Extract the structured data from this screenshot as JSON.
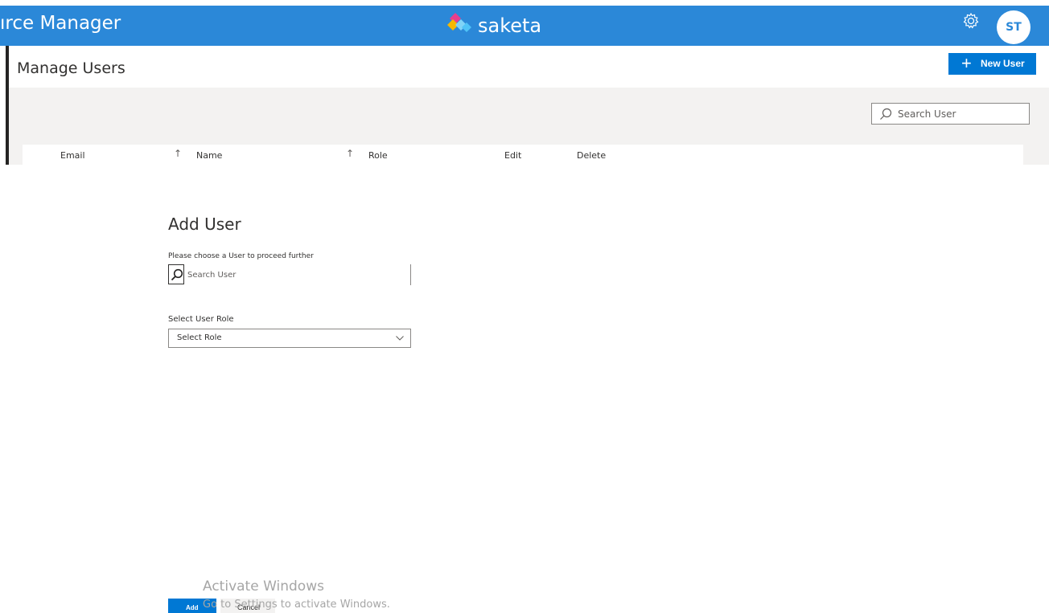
{
  "header": {
    "app_title": "ırce Manager",
    "brand": "saketa",
    "avatar_initials": "ST",
    "accent_color": "#2b88d8"
  },
  "manage_users": {
    "title": "Manage Users",
    "new_user_label": "New User",
    "search_placeholder": "Search User",
    "columns": [
      "Email",
      "Name",
      "Role",
      "Edit",
      "Delete"
    ]
  },
  "dialog": {
    "title": "Add User",
    "user_prompt": "Please choose a User to proceed further",
    "user_search_placeholder": "Search User",
    "role_label": "Select User Role",
    "role_value": "Select Role",
    "add_label": "Add",
    "cancel_label": "Cancel"
  },
  "watermark": {
    "line1": "Activate Windows",
    "line2": "Go to Settings to activate Windows."
  }
}
